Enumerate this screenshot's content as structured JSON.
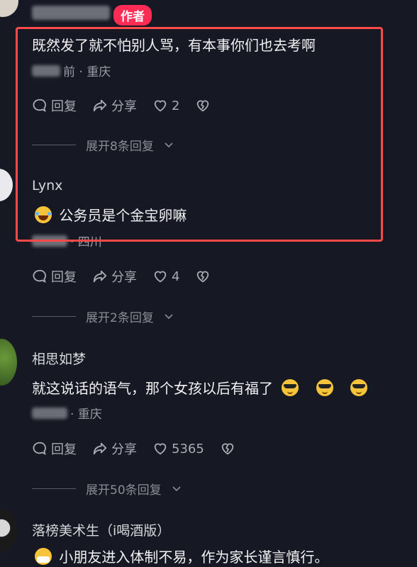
{
  "author_badge": "作者",
  "comments": [
    {
      "text": "既然发了就不怕别人骂，有本事你们也去考啊",
      "meta_suffix": "前 · 重庆",
      "reply_label": "回复",
      "share_label": "分享",
      "likes": "2",
      "expand_label": "展开8条回复"
    },
    {
      "name": "Lynx",
      "text": "公务员是个金宝卵嘛",
      "meta_suffix": "· 四川",
      "reply_label": "回复",
      "share_label": "分享",
      "likes": "4",
      "expand_label": "展开2条回复"
    },
    {
      "name": "相思如梦",
      "text": "就这说话的语气，那个女孩以后有福了",
      "meta_suffix": "· 重庆",
      "reply_label": "回复",
      "share_label": "分享",
      "likes": "5365",
      "expand_label": "展开50条回复"
    },
    {
      "name": "落榜美术生（i喝酒版）",
      "text": "小朋友进入体制不易，作为家长谨言慎行。"
    }
  ],
  "colors": {
    "background": "#161823",
    "badge": "#fe2c55",
    "highlight_border": "#ff4a4a"
  }
}
